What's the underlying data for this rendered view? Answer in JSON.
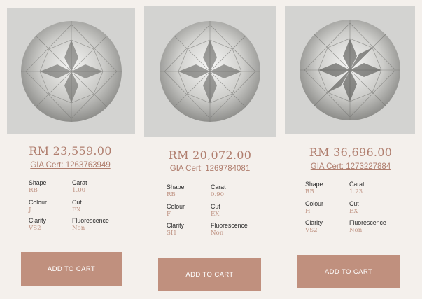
{
  "products": [
    {
      "price": "RM 23,559.00",
      "cert": "GIA Cert: 1263763949",
      "specs": {
        "shape_label": "Shape",
        "shape": "RB",
        "carat_label": "Carat",
        "carat": "1.00",
        "colour_label": "Colour",
        "colour": "J",
        "cut_label": "Cut",
        "cut": "EX",
        "clarity_label": "Clarity",
        "clarity": "VS2",
        "fluorescence_label": "Fluorescence",
        "fluorescence": "Non"
      },
      "button": "ADD TO CART",
      "image_icon": "diamond-photo"
    },
    {
      "price": "RM 20,072.00",
      "cert": "GIA Cert: 1269784081",
      "specs": {
        "shape_label": "Shape",
        "shape": "RB",
        "carat_label": "Carat",
        "carat": "0.90",
        "colour_label": "Colour",
        "colour": "F",
        "cut_label": "Cut",
        "cut": "EX",
        "clarity_label": "Clarity",
        "clarity": "SI1",
        "fluorescence_label": "Fluorescence",
        "fluorescence": "Non"
      },
      "button": "ADD TO CART",
      "image_icon": "diamond-photo"
    },
    {
      "price": "RM 36,696.00",
      "cert": "GIA Cert: 1273227884",
      "specs": {
        "shape_label": "Shape",
        "shape": "RB",
        "carat_label": "Carat",
        "carat": "1.23",
        "colour_label": "Colour",
        "colour": "H",
        "cut_label": "Cut",
        "cut": "EX",
        "clarity_label": "Clarity",
        "clarity": "VS2",
        "fluorescence_label": "Fluorescence",
        "fluorescence": "Non"
      },
      "button": "ADD TO CART",
      "image_icon": "diamond-photo"
    }
  ],
  "colors": {
    "background": "#f4f0ec",
    "accent": "#b07e6e",
    "button": "#c0907e",
    "photo_bg": "#d3d3d1"
  }
}
